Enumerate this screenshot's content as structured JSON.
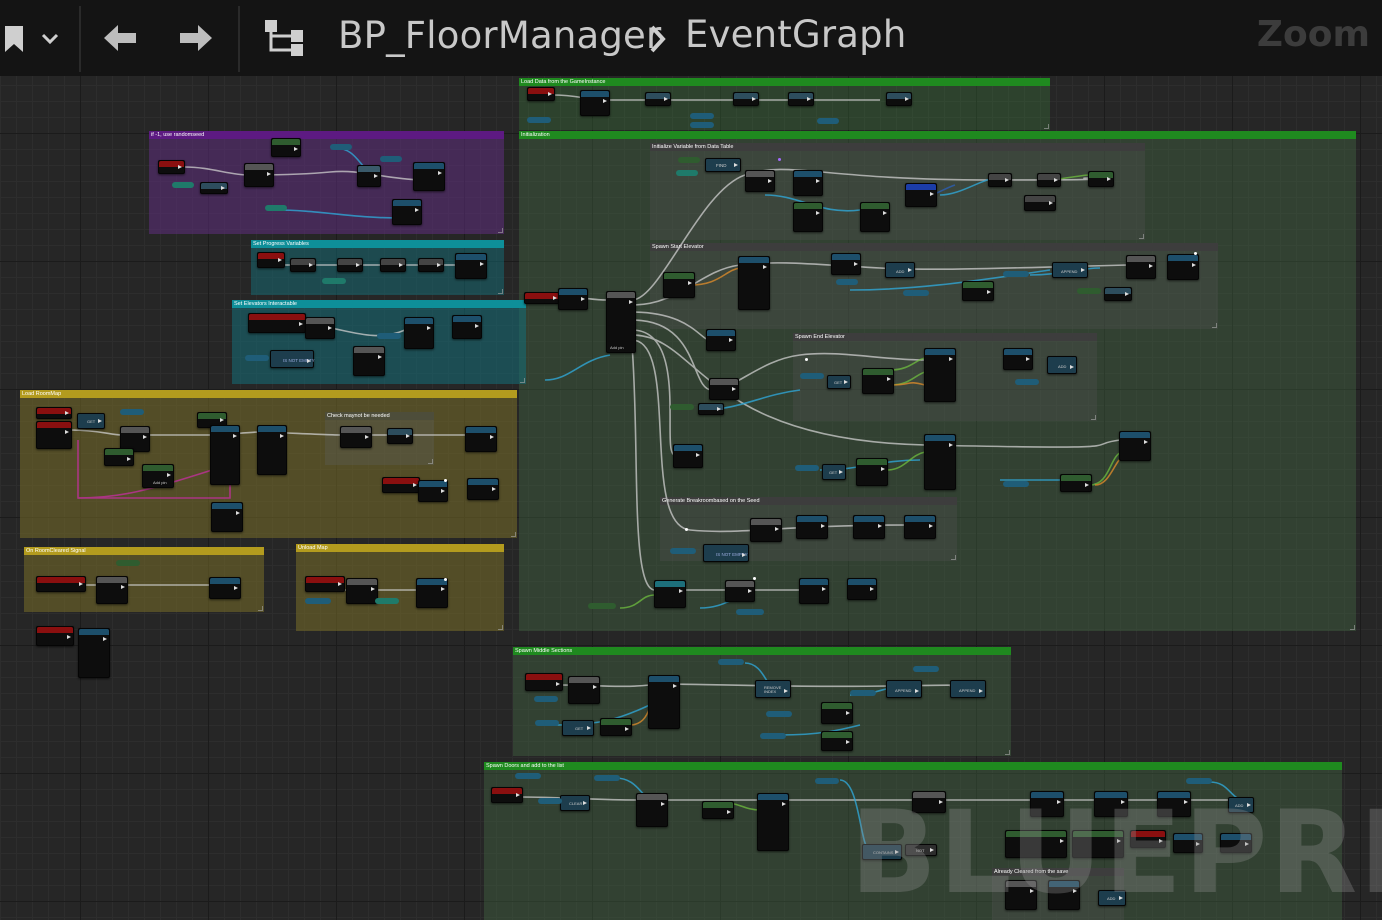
{
  "toolbar": {
    "breadcrumb_blueprint": "BP_FloorManager",
    "breadcrumb_graph": "EventGraph",
    "zoom_label": "Zoom",
    "icons": [
      "bookmark-icon",
      "chevron-down-icon",
      "back-arrow-icon",
      "forward-arrow-icon",
      "hierarchy-icon",
      "chevron-right-icon"
    ]
  },
  "watermark": "BLUEPRINT",
  "comments": [
    {
      "id": "load-data",
      "title": "Load Data from the GameInstance",
      "color": "#1f8a1f"
    },
    {
      "id": "initialization",
      "title": "Initialization",
      "color": "#1f8a1f"
    },
    {
      "id": "init-vars",
      "title": "Initialize Variable  from Data Table",
      "color": "#3a3a3a"
    },
    {
      "id": "spawn-start",
      "title": "Spawn Start Elevator",
      "color": "#3a3a3a"
    },
    {
      "id": "spawn-end",
      "title": "Spawn End Elevator",
      "color": "#3a3a3a"
    },
    {
      "id": "gen-break",
      "title": "Generate Breakroombased on the Seed",
      "color": "#3a3a3a"
    },
    {
      "id": "random-seed",
      "title": "if -1, use randomseed",
      "color": "#5d1a82"
    },
    {
      "id": "progress",
      "title": "Set Progress Variables",
      "color": "#0e8f99"
    },
    {
      "id": "elevators",
      "title": "Set Elevators Interactable",
      "color": "#0e8f99"
    },
    {
      "id": "load-room",
      "title": "Load RoomMap",
      "color": "#b39b1e"
    },
    {
      "id": "check",
      "title": "Check maynot be needed",
      "color": "#4d4d3a"
    },
    {
      "id": "room-cleared",
      "title": "On RoomCleared Signal",
      "color": "#b39b1e"
    },
    {
      "id": "unload",
      "title": "Unload Map",
      "color": "#b39b1e"
    },
    {
      "id": "middle",
      "title": "Spawn Middle Sections",
      "color": "#1f8a1f"
    },
    {
      "id": "doors",
      "title": "Spawn Doors and add to the list",
      "color": "#1f8a1f"
    },
    {
      "id": "already-cleared",
      "title": "Already Cleared from the save",
      "color": "#3a3a3a"
    }
  ],
  "node_labels": {
    "find": "FIND",
    "get": "GET",
    "add": "ADD",
    "append": "APPEND",
    "is_not_empty": "IS NOT EMPTY",
    "remove_index": "REMOVE INDEX",
    "clear": "CLEAR",
    "contains": "CONTAINS",
    "not": "NOT",
    "add_pin": "Add pin"
  },
  "colors": {
    "exec_wire": "#cfcfcf",
    "object_wire": "#2fa6d6",
    "struct_wire": "#1b5cb0",
    "float_wire": "#8fd14f",
    "bool_wire": "#8b0000",
    "int_wire": "#2ed1b1",
    "class_wire": "#8a2be2"
  }
}
